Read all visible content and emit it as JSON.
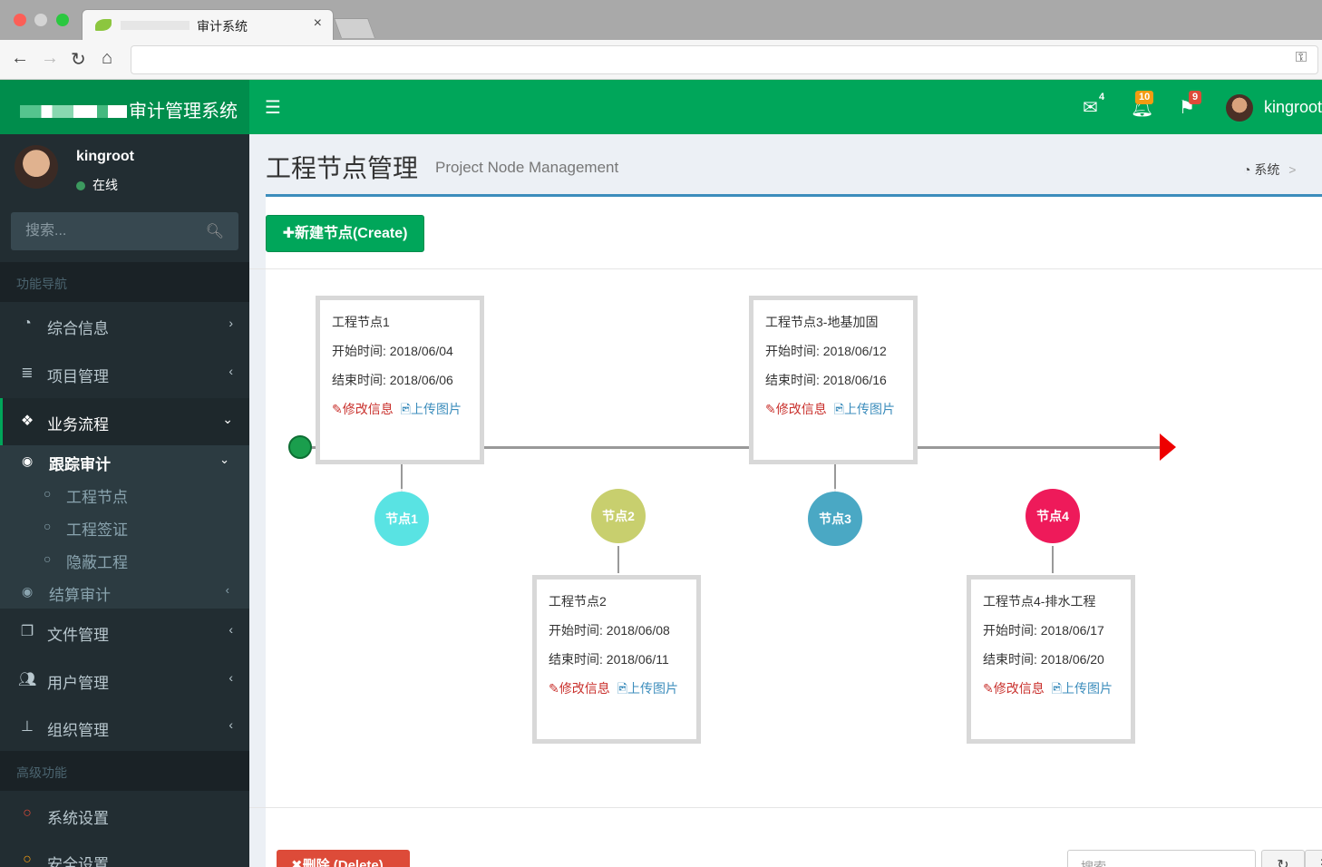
{
  "browser": {
    "tab_title": "审计系统",
    "tab_close": "×",
    "url": ""
  },
  "header": {
    "app_title": "审计管理系统",
    "menu_toggle_icon": "hamburger-icon",
    "messages_count": "4",
    "notifications_count": "10",
    "tasks_count": "9",
    "username": "kingroot",
    "colors": {
      "primary": "#00a65a",
      "logo_bg": "#008d4c",
      "badge_orange": "#f39c12",
      "badge_red": "#dd4b39"
    }
  },
  "sidebar": {
    "user": {
      "name": "kingroot",
      "status": "在线"
    },
    "search_placeholder": "搜索...",
    "section_nav": "功能导航",
    "section_advanced": "高级功能",
    "menu": [
      {
        "label": "综合信息",
        "icon": "dashboard-icon"
      },
      {
        "label": "项目管理",
        "icon": "list-icon"
      },
      {
        "label": "业务流程",
        "icon": "cubes-icon"
      },
      {
        "label": "文件管理",
        "icon": "files-icon"
      },
      {
        "label": "用户管理",
        "icon": "users-icon"
      },
      {
        "label": "组织管理",
        "icon": "sitemap-icon"
      }
    ],
    "submenu": {
      "track": "跟踪审计",
      "items": [
        "工程节点",
        "工程签证",
        "隐蔽工程"
      ],
      "settle": "结算审计"
    },
    "advanced": [
      {
        "label": "系统设置",
        "color": "#dd4b39"
      },
      {
        "label": "安全设置",
        "color": "#f39c12"
      }
    ]
  },
  "page": {
    "title": "工程节点管理",
    "subtitle": "Project Node Management",
    "breadcrumb_root": "系统",
    "breadcrumb_sep": ">",
    "create_button": "✚新建节点(Create)",
    "delete_button": "✖删除 (Delete)",
    "table_search_placeholder": "搜索"
  },
  "timeline": {
    "nodes": [
      {
        "label": "节点1",
        "color": "#59e3e3",
        "name": "工程节点1",
        "start": "开始时间: 2018/06/04",
        "end": "结束时间: 2018/06/06",
        "edit": "修改信息",
        "upload": "上传图片"
      },
      {
        "label": "节点2",
        "color": "#c8cf6e",
        "name": "工程节点2",
        "start": "开始时间: 2018/06/08",
        "end": "结束时间: 2018/06/11",
        "edit": "修改信息",
        "upload": "上传图片"
      },
      {
        "label": "节点3",
        "color": "#4aa8c4",
        "name": "工程节点3-地基加固",
        "start": "开始时间: 2018/06/12",
        "end": "结束时间: 2018/06/16",
        "edit": "修改信息",
        "upload": "上传图片"
      },
      {
        "label": "节点4",
        "color": "#ee1a5a",
        "name": "工程节点4-排水工程",
        "start": "开始时间: 2018/06/17",
        "end": "结束时间: 2018/06/20",
        "edit": "修改信息",
        "upload": "上传图片"
      }
    ]
  }
}
